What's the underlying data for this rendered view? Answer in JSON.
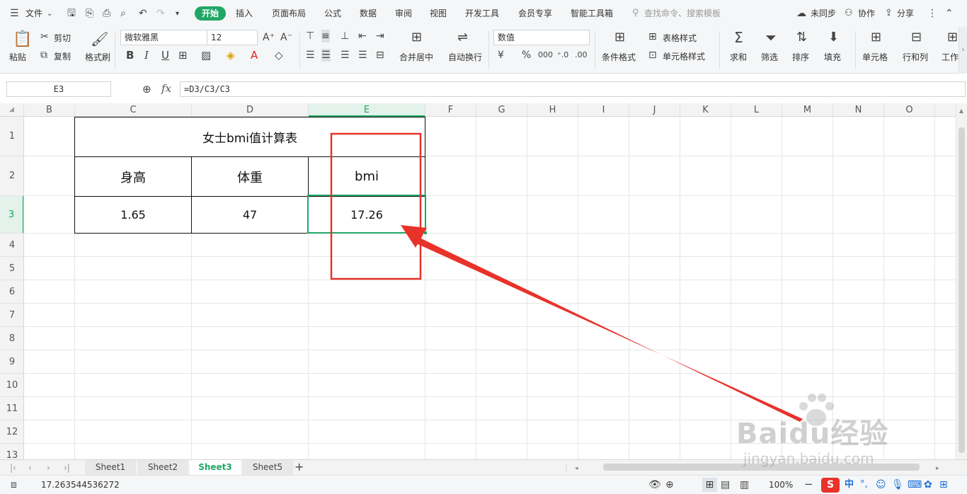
{
  "menubar": {
    "file": "文件",
    "tabs": [
      "开始",
      "插入",
      "页面布局",
      "公式",
      "数据",
      "审阅",
      "视图",
      "开发工具",
      "会员专享",
      "智能工具箱"
    ],
    "search_placeholder": "查找命令、搜索模板",
    "sync": "未同步",
    "collab": "协作",
    "share": "分享"
  },
  "ribbon": {
    "paste": "粘贴",
    "cut": "剪切",
    "copy": "复制",
    "format_painter": "格式刷",
    "font_name": "微软雅黑",
    "font_size": "12",
    "merge_center": "合并居中",
    "wrap_text": "自动换行",
    "number_format": "数值",
    "cond_format": "条件格式",
    "table_style": "表格样式",
    "cell_style": "单元格样式",
    "sum": "求和",
    "filter": "筛选",
    "sort": "排序",
    "fill": "填充",
    "cell": "单元格",
    "row_col": "行和列",
    "worksheet": "工作"
  },
  "formula_bar": {
    "name_box": "E3",
    "fx": "fx",
    "formula": "=D3/C3/C3"
  },
  "columns": [
    "B",
    "C",
    "D",
    "E",
    "F",
    "G",
    "H",
    "I",
    "J",
    "K",
    "L",
    "M",
    "N",
    "O"
  ],
  "rows": [
    "1",
    "2",
    "3",
    "4",
    "5",
    "6",
    "7",
    "8",
    "9",
    "10",
    "11",
    "12",
    "13"
  ],
  "table": {
    "title": "女士bmi值计算表",
    "headers": [
      "身高",
      "体重",
      "bmi"
    ],
    "values": [
      "1.65",
      "47",
      "17.26"
    ]
  },
  "sheets": [
    "Sheet1",
    "Sheet2",
    "Sheet3",
    "Sheet5"
  ],
  "active_sheet": "Sheet3",
  "status": {
    "value": "17.263544536272",
    "zoom": "100%"
  },
  "watermark": {
    "brand": "Baidu经验",
    "url": "jingyan.baidu.com"
  },
  "colors": {
    "accent": "#1fa766",
    "annotation": "#e8322a"
  }
}
